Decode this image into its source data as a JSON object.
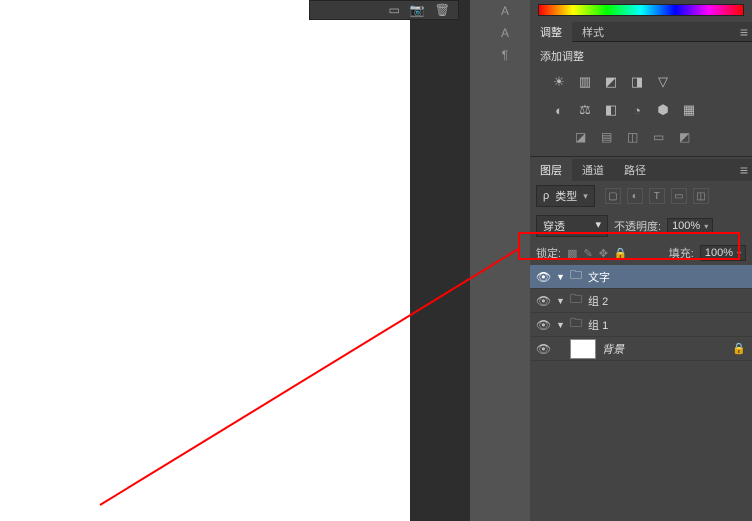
{
  "adjustments": {
    "tab_adjustments": "调整",
    "tab_styles": "样式",
    "add_adjustment": "添加调整"
  },
  "layers": {
    "tab_layers": "图层",
    "tab_channels": "通道",
    "tab_paths": "路径",
    "filter_label": "类型",
    "blend_mode": "穿透",
    "opacity_label": "不透明度:",
    "opacity_value": "100%",
    "lock_label": "锁定:",
    "fill_label": "填充:",
    "fill_value": "100%",
    "items": [
      {
        "name": "文字"
      },
      {
        "name": "组 2"
      },
      {
        "name": "组 1"
      },
      {
        "name": "背景"
      }
    ]
  }
}
